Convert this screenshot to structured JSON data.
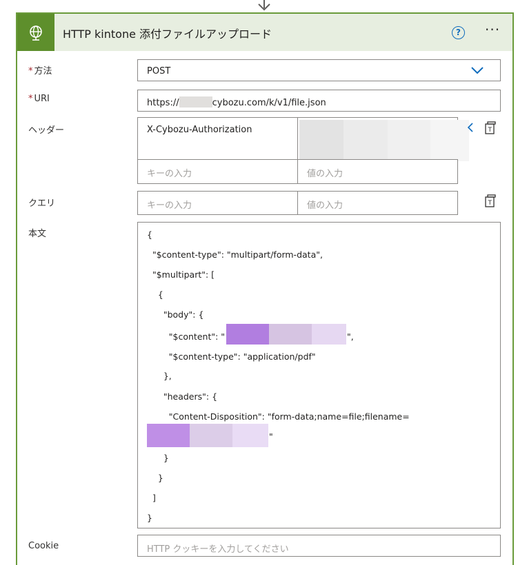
{
  "header": {
    "title": "HTTP kintone 添付ファイルアップロード",
    "help_glyph": "?",
    "more_glyph": "···",
    "icon": "globe-icon",
    "accent_color": "#5e8f2c"
  },
  "method": {
    "required_mark": "*",
    "label": "方法",
    "value": "POST"
  },
  "uri": {
    "required_mark": "*",
    "label": "URI",
    "prefix": "https://",
    "suffix": "cybozu.com/k/v1/file.json"
  },
  "headers": {
    "label": "ヘッダー",
    "rows": [
      {
        "key": "X-Cybozu-Authorization",
        "value": ""
      }
    ],
    "key_placeholder": "キーの入力",
    "value_placeholder": "値の入力"
  },
  "query": {
    "label": "クエリ",
    "key_placeholder": "キーの入力",
    "value_placeholder": "値の入力"
  },
  "body": {
    "label": "本文",
    "lines": [
      "{",
      "  \"$content-type\": \"multipart/form-data\",",
      "  \"$multipart\": [",
      "    {",
      "      \"body\": {",
      "        \"$content\": \"",
      "        \"$content-type\": \"application/pdf\"",
      "      },",
      "      \"headers\": {",
      "        \"Content-Disposition\": \"form-data;name=file;filename=",
      "\"",
      "      }",
      "    }",
      "  ]",
      "}"
    ],
    "content_close": "\","
  },
  "cookie": {
    "label": "Cookie",
    "placeholder": "HTTP クッキーを入力してください"
  }
}
